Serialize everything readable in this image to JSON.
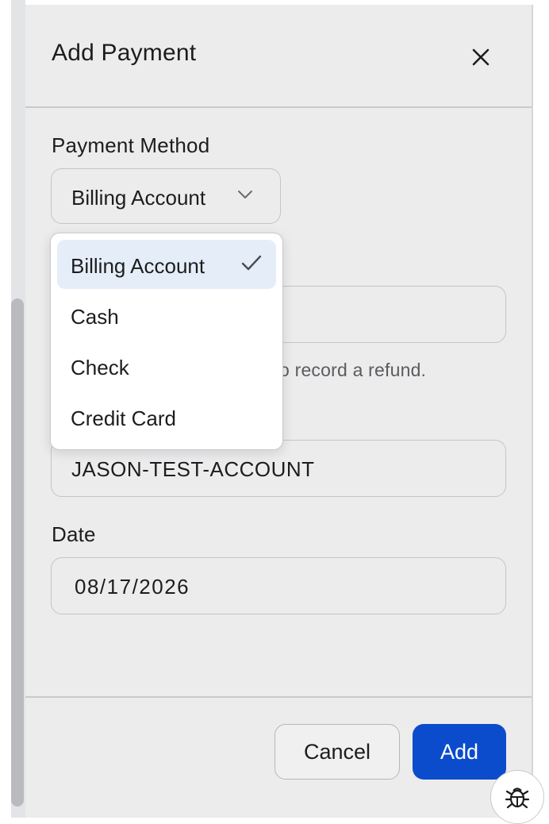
{
  "dialog": {
    "title": "Add Payment",
    "close_icon": "close-icon"
  },
  "payment_method": {
    "label": "Payment Method",
    "selected": "Billing Account",
    "options": [
      "Billing Account",
      "Cash",
      "Check",
      "Credit Card"
    ]
  },
  "amount": {
    "helper_visible_fragment": "o record a refund."
  },
  "account": {
    "value": "JASON-TEST-ACCOUNT"
  },
  "date": {
    "label": "Date",
    "value": "08/17/2026"
  },
  "footer": {
    "cancel_label": "Cancel",
    "add_label": "Add"
  },
  "colors": {
    "primary": "#0b4ccc",
    "selected_option_bg": "#e5eef8",
    "panel_bg": "#ececed"
  },
  "icons": {
    "debug": "bug-icon",
    "chevron": "chevron-down-icon",
    "check": "check-icon"
  }
}
